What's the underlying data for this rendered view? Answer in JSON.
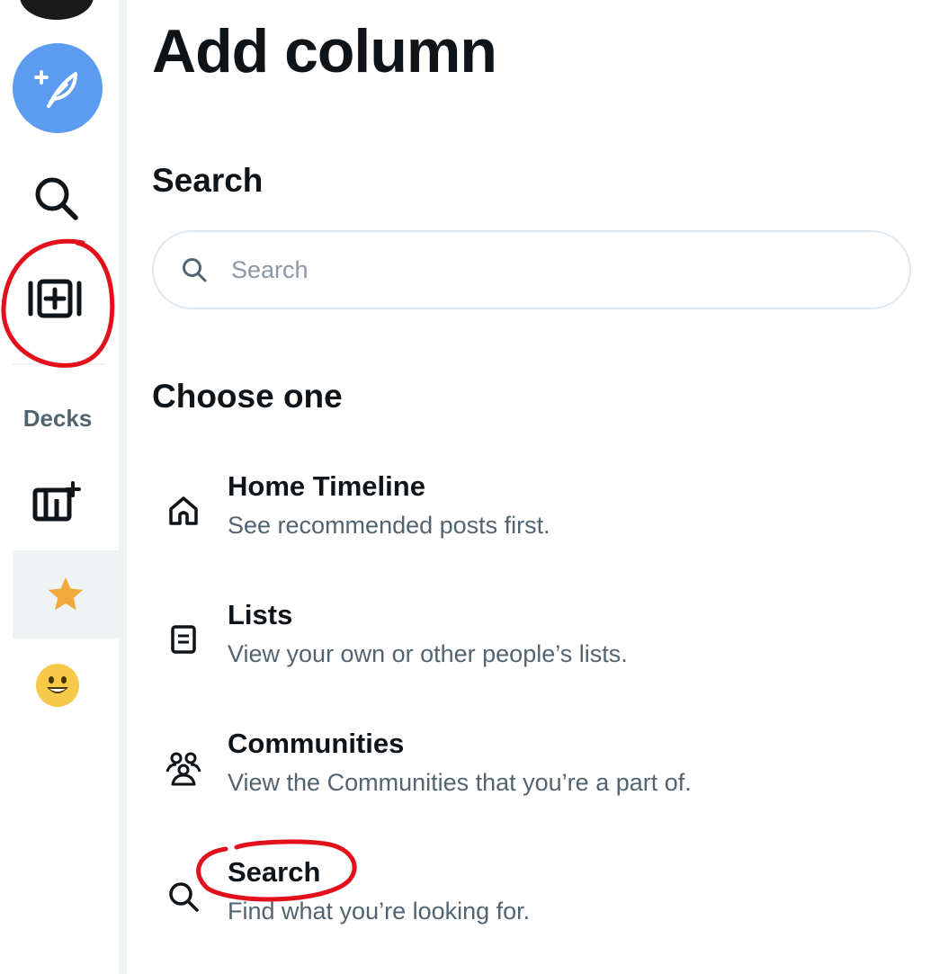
{
  "colors": {
    "accent": "#5b9cf0",
    "annotation": "#e3101c",
    "star": "#f2a93b",
    "emoji": "#f7c948",
    "muted_text": "#536471"
  },
  "rail": {
    "compose_icon": "feather-plus-icon",
    "search_icon": "search-icon",
    "add_column_icon": "add-column-icon",
    "decks_label": "Decks",
    "new_deck_icon": "new-deck-icon",
    "favorite_deck_icon": "star-icon",
    "emoji_deck_icon": "smiley-icon"
  },
  "main": {
    "title": "Add column",
    "search_section_title": "Search",
    "search_placeholder": "Search",
    "choose_title": "Choose one",
    "options": [
      {
        "icon": "home-icon",
        "title": "Home Timeline",
        "description": "See recommended posts first."
      },
      {
        "icon": "list-icon",
        "title": "Lists",
        "description": "View your own or other people’s lists."
      },
      {
        "icon": "communities-icon",
        "title": "Communities",
        "description": "View the Communities that you’re a part of."
      },
      {
        "icon": "search-icon",
        "title": "Search",
        "description": "Find what you’re looking for."
      }
    ]
  }
}
